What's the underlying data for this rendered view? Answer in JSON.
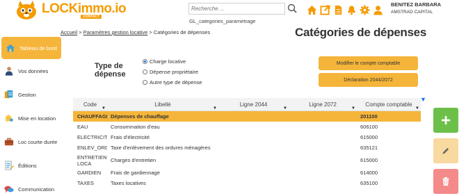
{
  "header": {
    "logo_text": "LOCKimmo",
    "logo_suffix": ".io",
    "logo_badge": "CONTACT",
    "search": {
      "placeholder": "Recherche ...",
      "value": ""
    },
    "page_id": "GL_categories_parametrage",
    "icons": [
      "home-icon",
      "external-link-icon",
      "document-icon",
      "bell-icon",
      "gear-icon",
      "user-icon"
    ],
    "user": {
      "name": "BENITEZ BARBARA",
      "company": "AMSTRAD CAPITAL"
    },
    "colors": {
      "accent": "#f59b00",
      "icon_orange": "#f59b00"
    }
  },
  "sidebar": {
    "items": [
      {
        "label": "Tableau de bord",
        "icon": "house-icon",
        "active": true
      },
      {
        "label": "Vos données",
        "icon": "person-icon",
        "active": false
      },
      {
        "label": "Gestion",
        "icon": "folders-icon",
        "active": false
      },
      {
        "label": "Mise en location",
        "icon": "key-house-icon",
        "active": false
      },
      {
        "label": "Loc courte durée",
        "icon": "suitcase-icon",
        "active": false
      },
      {
        "label": "Éditions",
        "icon": "edit-doc-icon",
        "active": false
      },
      {
        "label": "Communication",
        "icon": "chat-icon",
        "active": false
      }
    ]
  },
  "breadcrumb": {
    "home": "Accueil",
    "sep1": ">",
    "params": "Paramètres gestion locative",
    "sep2": ">",
    "current": "Catégories de dépenses"
  },
  "page_title": "Catégories de dépenses",
  "type_depense": {
    "label_line1": "Type de",
    "label_line2": "dépense",
    "options": [
      {
        "label": "Charge locative",
        "checked": true
      },
      {
        "label": "Dépense propriétaire",
        "checked": false
      },
      {
        "label": "Autre type de dépense",
        "checked": false
      }
    ]
  },
  "buttons": {
    "modify_account": "Modifier le compte comptable",
    "declaration": "Déclaration 2044/2072"
  },
  "table": {
    "headers": [
      "Code",
      "Libellé",
      "Ligne 2044",
      "Ligne 2072",
      "Compte comptable"
    ],
    "rows": [
      {
        "code": "CHAUFFAGE",
        "libelle": "Dépenses de chauffage",
        "ligne2044": "",
        "ligne2072": "",
        "compte": "201100",
        "selected": true
      },
      {
        "code": "EAU",
        "libelle": "Consommation d'eau",
        "ligne2044": "",
        "ligne2072": "",
        "compte": "606100",
        "selected": false
      },
      {
        "code": "ELECTRICIT",
        "libelle": "Frais d'électricité",
        "ligne2044": "",
        "ligne2072": "",
        "compte": "615000",
        "selected": false
      },
      {
        "code": "ENLEV_ORD",
        "libelle": "Taxe d'enlèvement des ordures ménagères",
        "ligne2044": "",
        "ligne2072": "",
        "compte": "635121",
        "selected": false
      },
      {
        "code": "ENTRETIEN LOCA",
        "libelle": "Charges d'entretien",
        "ligne2044": "",
        "ligne2072": "",
        "compte": "615000",
        "selected": false
      },
      {
        "code": "GARDIEN",
        "libelle": "Frais de gardiennage",
        "ligne2044": "",
        "ligne2072": "",
        "compte": "614000",
        "selected": false
      },
      {
        "code": "TAXES",
        "libelle": "Taxes locatives",
        "ligne2044": "",
        "ligne2072": "",
        "compte": "635100",
        "selected": false
      }
    ]
  },
  "actions": {
    "add": "plus-icon",
    "edit": "pencil-icon",
    "delete": "trash-icon",
    "colors": {
      "add": "#6cc04a",
      "edit": "#f8d9a0",
      "delete": "#f48a8a"
    }
  }
}
